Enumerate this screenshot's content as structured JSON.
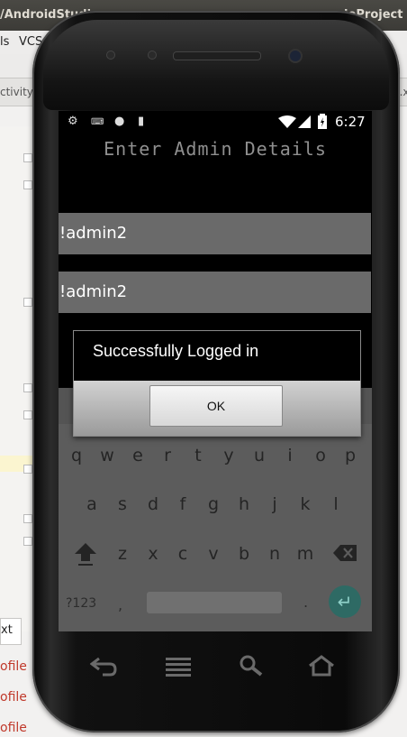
{
  "ide": {
    "title_left": "/AndroidStudi",
    "title_right": "ioProject",
    "menu": [
      "ls",
      "VCS"
    ],
    "tab_left": "ctivity",
    "tab_right": "n.x",
    "code_chars": [
      {
        "text": "i"
      },
      {
        "text": "o"
      },
      {
        "text": "i"
      },
      {
        "text": "i"
      },
      {
        "text": "i"
      },
      {
        "text": "i"
      }
    ],
    "bottom_tab": "xt",
    "log_lines": [
      "ofile",
      "ofile",
      "ofile"
    ]
  },
  "statusbar": {
    "icons": [
      "gear-icon",
      "keyboard-icon",
      "circle-icon",
      "sdcard-icon"
    ],
    "time": "6:27"
  },
  "app": {
    "heading": "Enter Admin Details",
    "username_value": "!admin2",
    "password_value": "!admin2"
  },
  "dialog": {
    "message": "Successfully Logged in",
    "ok_label": "OK"
  },
  "keyboard": {
    "row1": [
      "q",
      "w",
      "e",
      "r",
      "t",
      "y",
      "u",
      "i",
      "o",
      "p"
    ],
    "row2": [
      "a",
      "s",
      "d",
      "f",
      "g",
      "h",
      "j",
      "k",
      "l"
    ],
    "row3": [
      "z",
      "x",
      "c",
      "v",
      "b",
      "n",
      "m"
    ],
    "symbols_label": "?123",
    "comma": ",",
    "period": "."
  },
  "nav": [
    "back-icon",
    "menu-icon",
    "search-icon",
    "home-icon"
  ]
}
